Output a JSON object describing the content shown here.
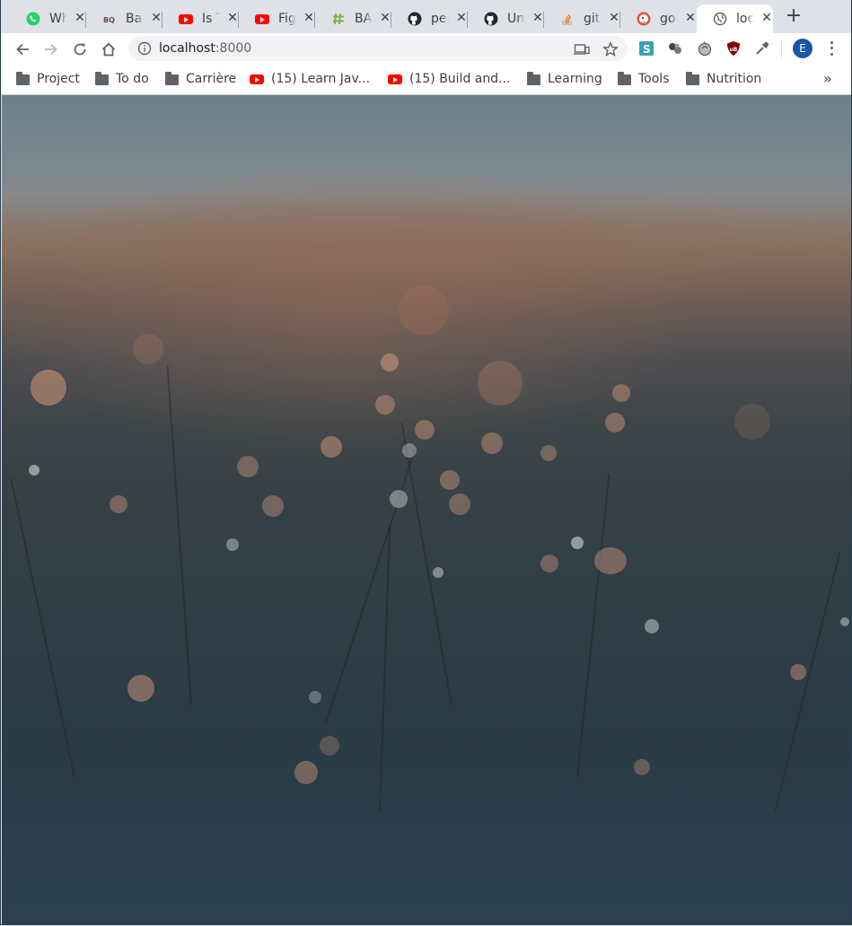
{
  "tabs": [
    {
      "title": "WhatsApp",
      "icon": "whatsapp-icon"
    },
    {
      "title": "BatchQuery",
      "icon": "bq-icon"
    },
    {
      "title": "Is This",
      "icon": "youtube-icon"
    },
    {
      "title": "Figma",
      "icon": "youtube-icon"
    },
    {
      "title": "BASH",
      "icon": "hashtag-icon"
    },
    {
      "title": "peu",
      "icon": "github-icon"
    },
    {
      "title": "Un",
      "icon": "github-icon"
    },
    {
      "title": "git",
      "icon": "stackoverflow-icon"
    },
    {
      "title": "goo",
      "icon": "duckduckgo-icon"
    },
    {
      "title": "loc",
      "icon": "globe-icon"
    }
  ],
  "active_tab": 9,
  "toolbar": {
    "url_host": "localhost",
    "url_port": ":8000",
    "avatar_letter": "E"
  },
  "bookmarks": [
    {
      "label": "Project",
      "icon": "folder-icon"
    },
    {
      "label": "To do",
      "icon": "folder-icon"
    },
    {
      "label": "Carrière",
      "icon": "folder-icon"
    },
    {
      "label": "(15) Learn Jav...",
      "icon": "youtube-icon"
    },
    {
      "label": "(15) Build and...",
      "icon": "youtube-icon"
    },
    {
      "label": "Learning",
      "icon": "folder-icon"
    },
    {
      "label": "Tools",
      "icon": "folder-icon"
    },
    {
      "label": "Nutrition",
      "icon": "folder-icon"
    }
  ],
  "colors": {
    "tabstrip": "#dee1e6",
    "toolbar": "#ffffff",
    "page_sky": "#6e8088",
    "page_bottom": "#2f4150",
    "bokeh": "#d49a7c"
  }
}
